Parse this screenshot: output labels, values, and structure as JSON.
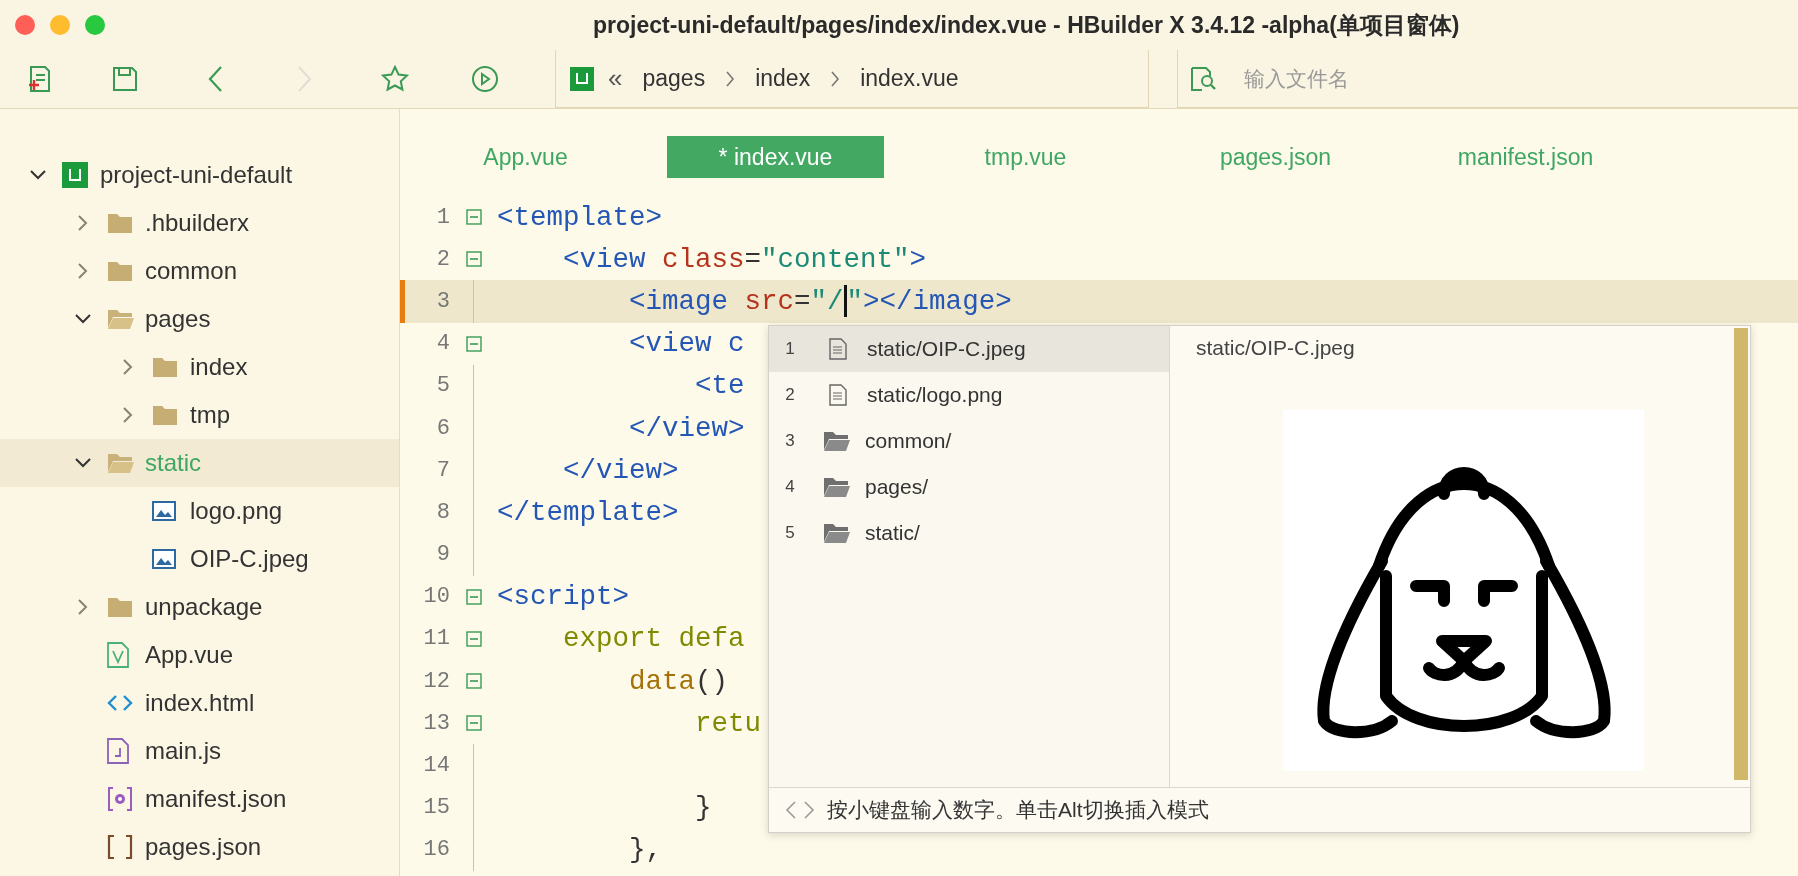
{
  "window": {
    "title": "project-uni-default/pages/index/index.vue - HBuilder X 3.4.12 -alpha(单项目窗体)"
  },
  "toolbar": [
    {
      "kind": "new-file",
      "disabled": false
    },
    {
      "kind": "save",
      "disabled": false
    },
    {
      "kind": "back",
      "disabled": false
    },
    {
      "kind": "forward",
      "disabled": true
    },
    {
      "kind": "favorite",
      "disabled": false
    },
    {
      "kind": "run",
      "disabled": false
    }
  ],
  "breadcrumb": {
    "back_symbol": "«",
    "items": [
      "pages",
      "index",
      "index.vue"
    ]
  },
  "file_search": {
    "placeholder": "输入文件名"
  },
  "sidebar": {
    "items": [
      {
        "label": "project-uni-default",
        "kind": "project",
        "expanded": true,
        "selected": false,
        "children": [
          {
            "label": ".hbuilderx",
            "kind": "folder",
            "expanded": false,
            "selected": false
          },
          {
            "label": "common",
            "kind": "folder",
            "expanded": false,
            "selected": false
          },
          {
            "label": "pages",
            "kind": "folder",
            "expanded": true,
            "selected": false,
            "children": [
              {
                "label": "index",
                "kind": "folder",
                "expanded": false,
                "selected": false
              },
              {
                "label": "tmp",
                "kind": "folder",
                "expanded": false,
                "selected": false
              }
            ]
          },
          {
            "label": "static",
            "kind": "folder",
            "expanded": true,
            "selected": true,
            "children": [
              {
                "label": "logo.png",
                "kind": "image",
                "selected": false
              },
              {
                "label": "OIP-C.jpeg",
                "kind": "image",
                "selected": false
              }
            ]
          },
          {
            "label": "unpackage",
            "kind": "folder",
            "expanded": false,
            "selected": false
          },
          {
            "label": "App.vue",
            "kind": "vue",
            "selected": false
          },
          {
            "label": "index.html",
            "kind": "html",
            "selected": false
          },
          {
            "label": "main.js",
            "kind": "js",
            "selected": false
          },
          {
            "label": "manifest.json",
            "kind": "manifest",
            "selected": false
          },
          {
            "label": "pages.json",
            "kind": "json",
            "selected": false
          }
        ]
      }
    ]
  },
  "tabs": [
    {
      "label": "App.vue",
      "selected": false
    },
    {
      "label": "* index.vue",
      "selected": true
    },
    {
      "label": "tmp.vue",
      "selected": false
    },
    {
      "label": "pages.json",
      "selected": false
    },
    {
      "label": "manifest.json",
      "selected": false
    }
  ],
  "editor": {
    "lines": [
      {
        "number": "1",
        "foldable": true,
        "current": false,
        "tokens": [
          {
            "text": "<template>",
            "kind": "tag"
          }
        ]
      },
      {
        "number": "2",
        "foldable": true,
        "current": false,
        "tokens": [
          {
            "text": "    <view",
            "kind": "tag"
          },
          {
            "text": " class",
            "kind": "attr"
          },
          {
            "text": "=",
            "kind": "punct"
          },
          {
            "text": "\"content\"",
            "kind": "str"
          },
          {
            "text": ">",
            "kind": "tag"
          }
        ]
      },
      {
        "number": "3",
        "foldable": false,
        "current": true,
        "tokens": [
          {
            "text": "        <image",
            "kind": "tag"
          },
          {
            "text": " src",
            "kind": "attr"
          },
          {
            "text": "=",
            "kind": "punct"
          },
          {
            "text": "\"/",
            "kind": "str",
            "cursor": true
          },
          {
            "text": "\"",
            "kind": "str"
          },
          {
            "text": "></image>",
            "kind": "tag"
          }
        ]
      },
      {
        "number": "4",
        "foldable": true,
        "current": false,
        "tokens": [
          {
            "text": "        <view c",
            "kind": "tag"
          }
        ]
      },
      {
        "number": "5",
        "foldable": false,
        "current": false,
        "tokens": [
          {
            "text": "            <te",
            "kind": "tag"
          }
        ]
      },
      {
        "number": "6",
        "foldable": false,
        "current": false,
        "tokens": [
          {
            "text": "        </view>",
            "kind": "tag"
          }
        ]
      },
      {
        "number": "7",
        "foldable": false,
        "current": false,
        "tokens": [
          {
            "text": "    </view>",
            "kind": "tag"
          }
        ]
      },
      {
        "number": "8",
        "foldable": false,
        "current": false,
        "tokens": [
          {
            "text": "</template>",
            "kind": "tag"
          }
        ]
      },
      {
        "number": "9",
        "foldable": false,
        "current": false
      },
      {
        "number": "10",
        "foldable": true,
        "current": false,
        "tokens": [
          {
            "text": "<script>",
            "kind": "tag"
          }
        ]
      },
      {
        "number": "11",
        "foldable": true,
        "current": false,
        "tokens": [
          {
            "text": "    export defa",
            "kind": "kw"
          }
        ]
      },
      {
        "number": "12",
        "foldable": true,
        "current": false,
        "tokens": [
          {
            "text": "        data",
            "kind": "fn"
          },
          {
            "text": "()",
            "kind": "punct"
          }
        ]
      },
      {
        "number": "13",
        "foldable": true,
        "current": false,
        "tokens": [
          {
            "text": "            retu",
            "kind": "kw"
          }
        ]
      },
      {
        "number": "14",
        "foldable": false,
        "current": false
      },
      {
        "number": "15",
        "foldable": false,
        "current": false,
        "tokens": [
          {
            "text": "            }",
            "kind": "punct"
          }
        ]
      },
      {
        "number": "16",
        "foldable": false,
        "current": false,
        "tokens": [
          {
            "text": "        },",
            "kind": "punct"
          }
        ]
      }
    ]
  },
  "completion": {
    "items": [
      {
        "number": "1",
        "kind": "file",
        "label": "static/OIP-C.jpeg",
        "selected": true
      },
      {
        "number": "2",
        "kind": "file",
        "label": "static/logo.png",
        "selected": false
      },
      {
        "number": "3",
        "kind": "folder",
        "label": "common/",
        "selected": false
      },
      {
        "number": "4",
        "kind": "folder",
        "label": "pages/",
        "selected": false
      },
      {
        "number": "5",
        "kind": "folder",
        "label": "static/",
        "selected": false
      }
    ],
    "preview_title": "static/OIP-C.jpeg",
    "hint": "按小键盘输入数字。单击Alt切换插入模式"
  }
}
